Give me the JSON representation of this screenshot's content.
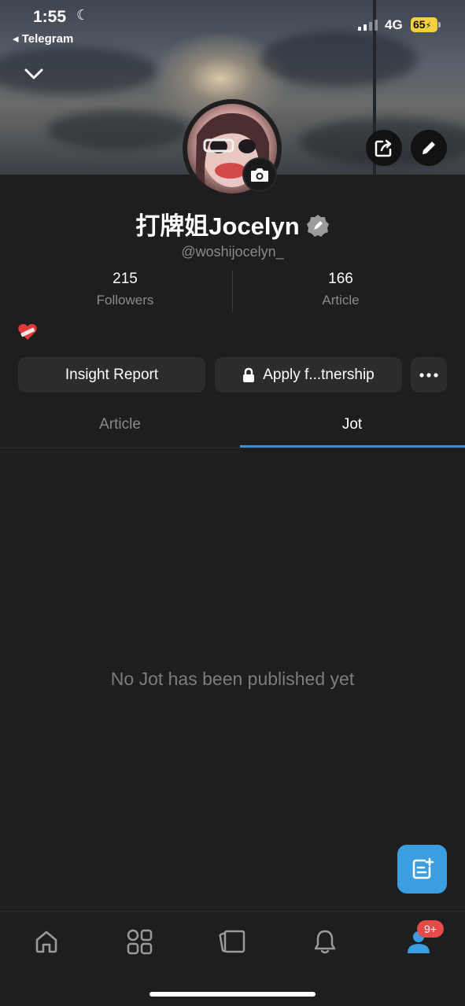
{
  "status_bar": {
    "time": "1:55",
    "back_app": "Telegram",
    "network": "4G",
    "battery": "65"
  },
  "profile": {
    "name": "打牌姐Jocelyn",
    "handle": "@woshijocelyn_",
    "bio_emoji": "❤️‍🩹",
    "stats": [
      {
        "value": "215",
        "label": "Followers"
      },
      {
        "value": "166",
        "label": "Article"
      }
    ]
  },
  "actions": {
    "insight_label": "Insight Report",
    "apply_label": "Apply f...tnership"
  },
  "tabs": [
    {
      "label": "Article",
      "active": false
    },
    {
      "label": "Jot",
      "active": true
    }
  ],
  "content": {
    "empty_message": "No Jot has been published yet"
  },
  "bottom_nav": {
    "items": [
      "home-icon",
      "apps-grid-icon",
      "cards-icon",
      "bell-icon",
      "profile-icon"
    ],
    "badge": "9+"
  },
  "colors": {
    "accent": "#3a8fd6",
    "fab": "#3b9ee0",
    "badge": "#e84a4a",
    "battery": "#f4d03f"
  }
}
